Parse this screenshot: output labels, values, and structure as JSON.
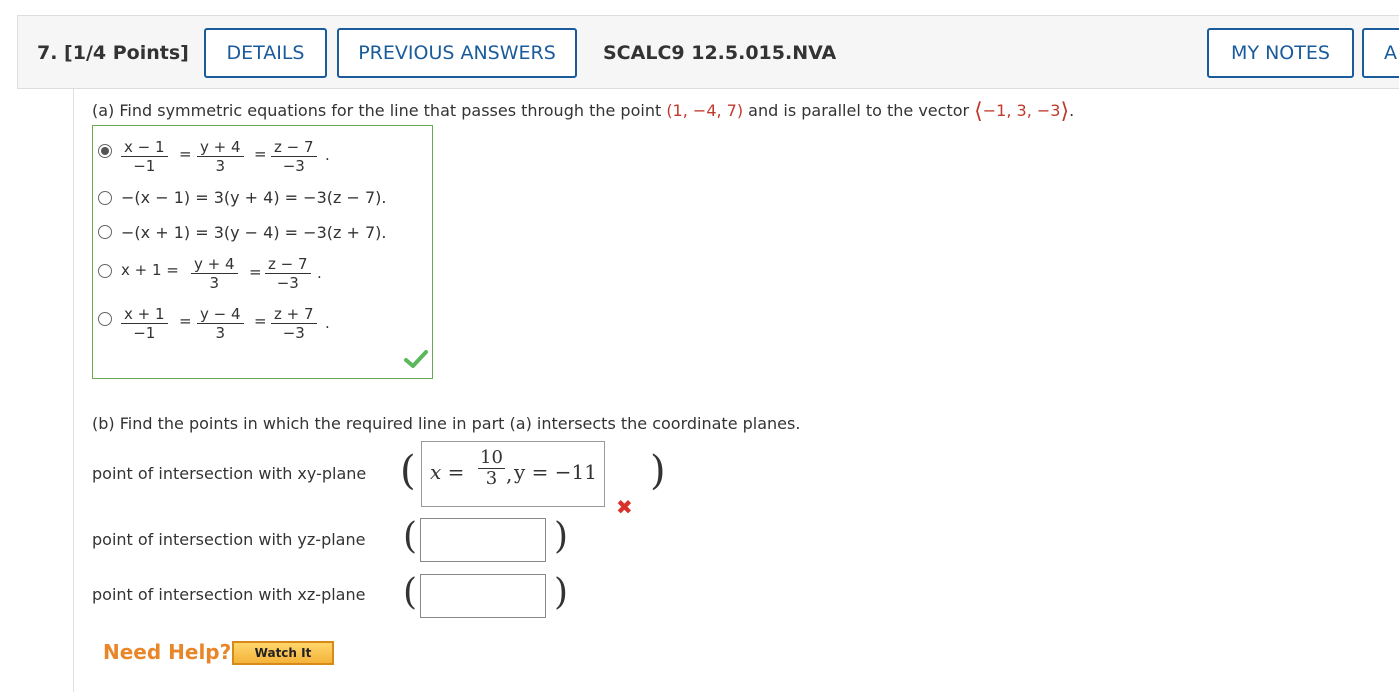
{
  "header": {
    "question_number": "7.  [1/4 Points]",
    "details_label": "DETAILS",
    "previous_answers_label": "PREVIOUS ANSWERS",
    "question_code": "SCALC9 12.5.015.NVA",
    "my_notes_label": "MY NOTES",
    "next_label": "A"
  },
  "part_a": {
    "prompt_start": "(a) Find symmetric equations for the line that passes through the point ",
    "point": "(1, −4, 7)",
    "prompt_mid": " and is parallel to the vector ",
    "vector": "−1, 3, −3",
    "prompt_end": ".",
    "choices": {
      "c1": {
        "n1": "x − 1",
        "d1": "−1",
        "n2": "y + 4",
        "d2": "3",
        "n3": "z − 7",
        "d3": "−3",
        "selected": true
      },
      "c2": {
        "text": "−(x − 1) = 3(y + 4) = −3(z − 7)."
      },
      "c3": {
        "text": "−(x + 1) = 3(y − 4) = −3(z + 7)."
      },
      "c4": {
        "lead": "x + 1 =",
        "n2": "y + 4",
        "d2": "3",
        "n3": "z − 7",
        "d3": "−3"
      },
      "c5": {
        "n1": "x + 1",
        "d1": "−1",
        "n2": "y − 4",
        "d2": "3",
        "n3": "z + 7",
        "d3": "−3"
      }
    },
    "equals": "=",
    "period": ".",
    "status_icon": "checkmark-icon"
  },
  "part_b": {
    "prompt": "(b) Find the points in which the required line in part (a) intersects the coordinate planes.",
    "xy_label": "point of intersection with xy-plane",
    "yz_label": "point of intersection with yz-plane",
    "xz_label": "point of intersection with xz-plane",
    "xy_answer": {
      "x_label": "x =",
      "x_num": "10",
      "x_den": "3",
      "comma": ",",
      "y_text": "y = −11"
    },
    "yz_answer": "",
    "xz_answer": "",
    "status_icon": "x-mark-icon"
  },
  "help": {
    "need_help": "Need Help?",
    "watch_it": "Watch It"
  },
  "colors": {
    "accent": "#1a5b9c",
    "correct": "#5cb85c",
    "incorrect": "#d9322a",
    "highlight": "#c0392b",
    "help": "#e8862a"
  }
}
